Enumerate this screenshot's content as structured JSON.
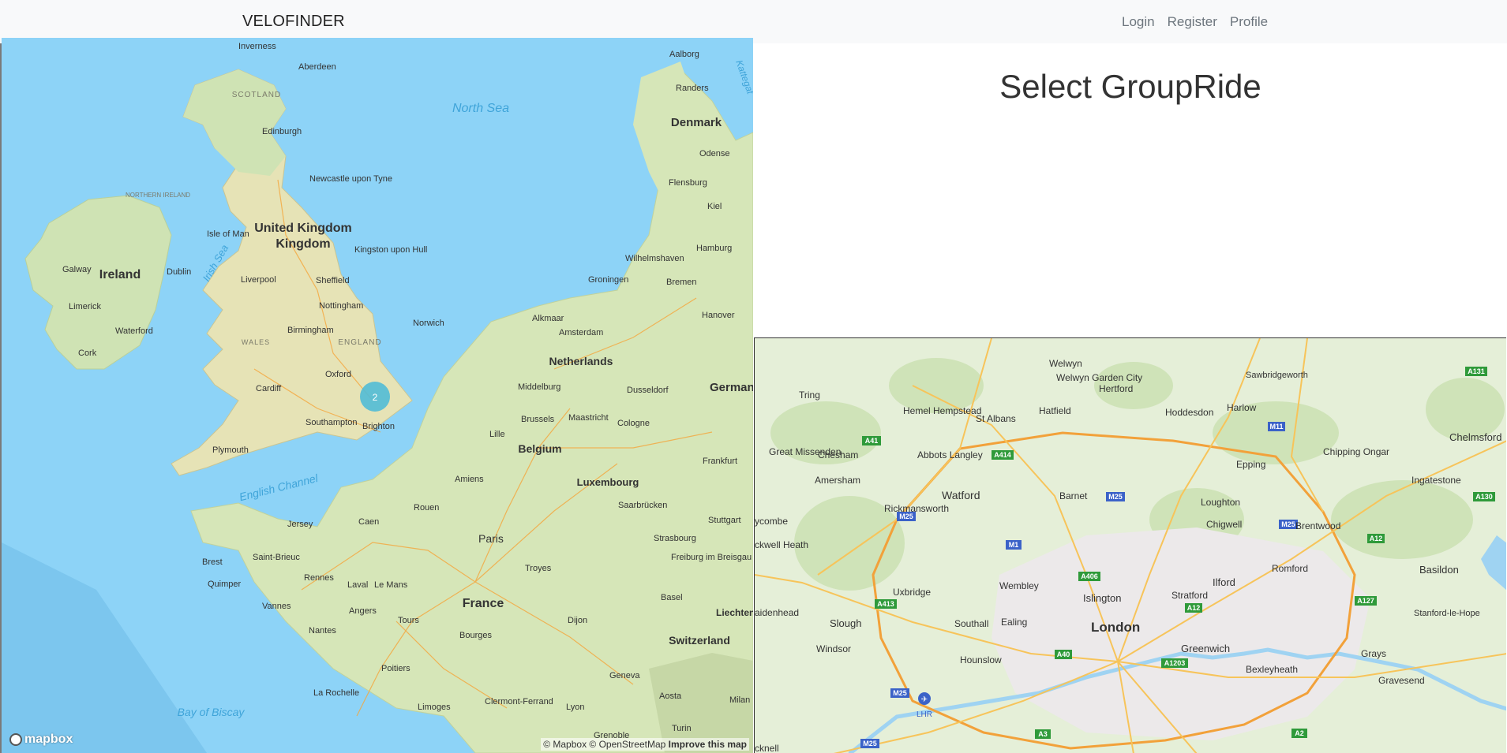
{
  "navbar": {
    "brand": "VELOFINDER",
    "links": [
      "Login",
      "Register",
      "Profile"
    ]
  },
  "page": {
    "title": "Select GroupRide"
  },
  "overview_map": {
    "cluster_count": "2",
    "attribution": "© Mapbox © OpenStreetMap",
    "improve_link": "Improve this map",
    "logo": "mapbox",
    "countries": [
      "United Kingdom",
      "Ireland",
      "France",
      "Belgium",
      "Netherlands",
      "Denmark",
      "Luxembourg",
      "Switzerland",
      "German",
      "Liechten"
    ],
    "regions": [
      "SCOTLAND",
      "NORTHERN IRELAND",
      "ENGLAND",
      "WALES"
    ],
    "seas": [
      "North Sea",
      "Irish Sea",
      "English Channel",
      "Bay of Biscay",
      "Kattegat"
    ],
    "places": [
      "Inverness",
      "Aberdeen",
      "Edinburgh",
      "Newcastle upon Tyne",
      "Isle of Man",
      "Kingston upon Hull",
      "Liverpool",
      "Sheffield",
      "Nottingham",
      "Birmingham",
      "Norwich",
      "Oxford",
      "Cardiff",
      "Southampton",
      "Brighton",
      "Plymouth",
      "Jersey",
      "Galway",
      "Dublin",
      "Limerick",
      "Waterford",
      "Cork",
      "Aalborg",
      "Randers",
      "Odense",
      "Flensburg",
      "Kiel",
      "Hamburg",
      "Wilhelmshaven",
      "Bremen",
      "Groningen",
      "Alkmaar",
      "Amsterdam",
      "Hanover",
      "Middelburg",
      "Dusseldorf",
      "Brussels",
      "Maastricht",
      "Cologne",
      "Lille",
      "Frankfurt",
      "Amiens",
      "Saarbrücken",
      "Rouen",
      "Caen",
      "Paris",
      "Stuttgart",
      "Strasbourg",
      "Freiburg im Breisgau",
      "Brest",
      "Saint-Brieuc",
      "Rennes",
      "Laval",
      "Le Mans",
      "Troyes",
      "Quimper",
      "Vannes",
      "Angers",
      "Tours",
      "Basel",
      "Nantes",
      "Dijon",
      "Bourges",
      "Poitiers",
      "La Rochelle",
      "Geneva",
      "Limoges",
      "Clermont-Ferrand",
      "Aosta",
      "Lyon",
      "Turin",
      "Grenoble",
      "Milan"
    ]
  },
  "detail_map": {
    "places": [
      "Welwyn",
      "Sawbridgeworth",
      "Tring",
      "Welwyn Garden City",
      "Hertford",
      "Hemel Hempstead",
      "St Albans",
      "Hatfield",
      "Hoddesdon",
      "Harlow",
      "Chelmsford",
      "Chesham",
      "Abbots Langley",
      "Great Missenden",
      "Chipping Ongar",
      "Epping",
      "Amersham",
      "Ingatestone",
      "Watford",
      "Barnet",
      "Rickmansworth",
      "Loughton",
      "Chigwell",
      "Brentwood",
      "ycombe",
      "ckwell Heath",
      "Romford",
      "Basildon",
      "Ilford",
      "Wembley",
      "Islington",
      "Stratford",
      "Uxbridge",
      "aidenhead",
      "Slough",
      "Southall",
      "Ealing",
      "London",
      "Stanford-le-Hope",
      "Windsor",
      "Greenwich",
      "Hounslow",
      "LHR",
      "Grays",
      "Bexleyheath",
      "Gravesend",
      "cknell"
    ],
    "road_shields": [
      "A131",
      "M11",
      "A41",
      "A414",
      "M25",
      "A12",
      "A130",
      "M1",
      "A406",
      "A413",
      "A127",
      "A40",
      "A1203",
      "A3",
      "A2"
    ]
  }
}
